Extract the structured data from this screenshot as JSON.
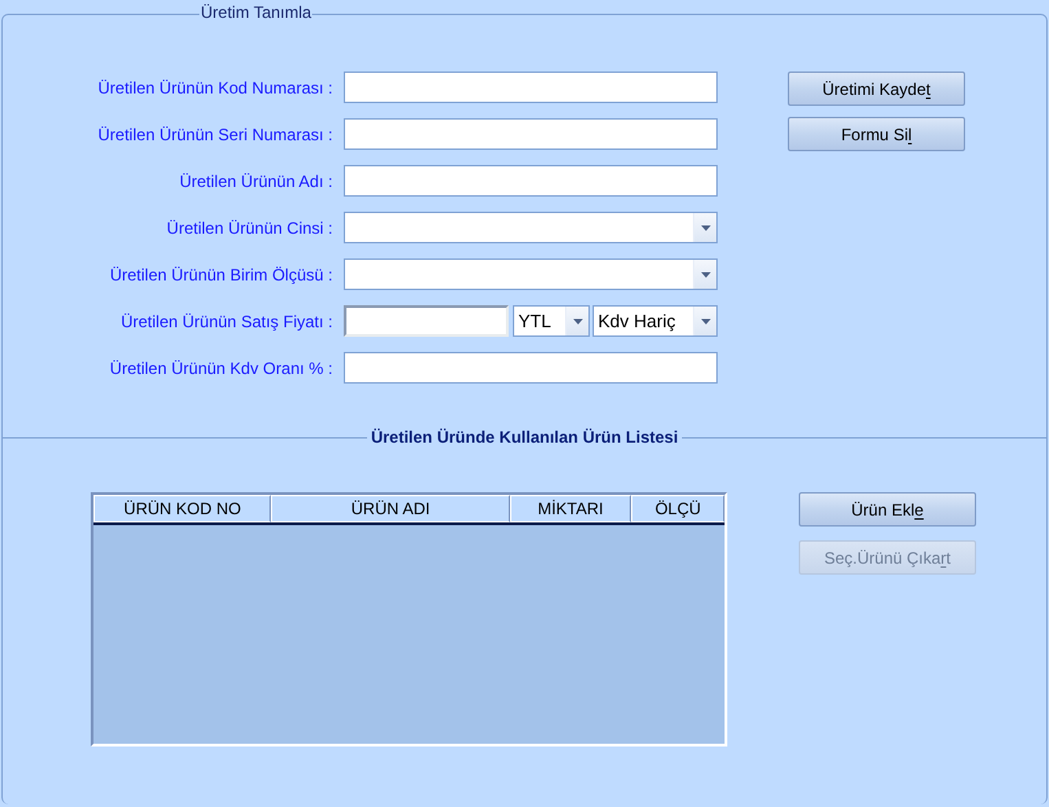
{
  "group_title": "Üretim Tanımla",
  "fields": [
    {
      "label": "Üretilen Ürünün Kod Numarası :",
      "kind": "text"
    },
    {
      "label": "Üretilen Ürünün Seri Numarası :",
      "kind": "text"
    },
    {
      "label": "Üretilen Ürünün Adı :",
      "kind": "text"
    },
    {
      "label": "Üretilen Ürünün Cinsi :",
      "kind": "combo"
    },
    {
      "label": "Üretilen Ürünün Birim Ölçüsü :",
      "kind": "combo"
    },
    {
      "label": "Üretilen Ürünün Satış Fiyatı :",
      "kind": "price",
      "currency": "YTL",
      "tax": "Kdv Hariç"
    },
    {
      "label": "Üretilen Ürünün Kdv Oranı % :",
      "kind": "text"
    }
  ],
  "buttons": [
    {
      "text_before": "Üretimi Kayde",
      "access_key": "t",
      "disabled": false
    },
    {
      "text_before": "Formu Si",
      "access_key": "l",
      "disabled": false
    }
  ],
  "list_section": {
    "title": "Üretilen Üründe Kullanılan Ürün Listesi",
    "table": {
      "columns": [
        "ÜRÜN KOD NO",
        "ÜRÜN ADI",
        "MİKTARI",
        "ÖLÇÜ"
      ]
    },
    "buttons": [
      {
        "text_before": "Ürün Ekl",
        "access_key": "e",
        "disabled": false
      },
      {
        "text_before": "Seç.Ürünü Çıka",
        "access_key": "r",
        "text_after": "t",
        "disabled": true
      }
    ]
  }
}
